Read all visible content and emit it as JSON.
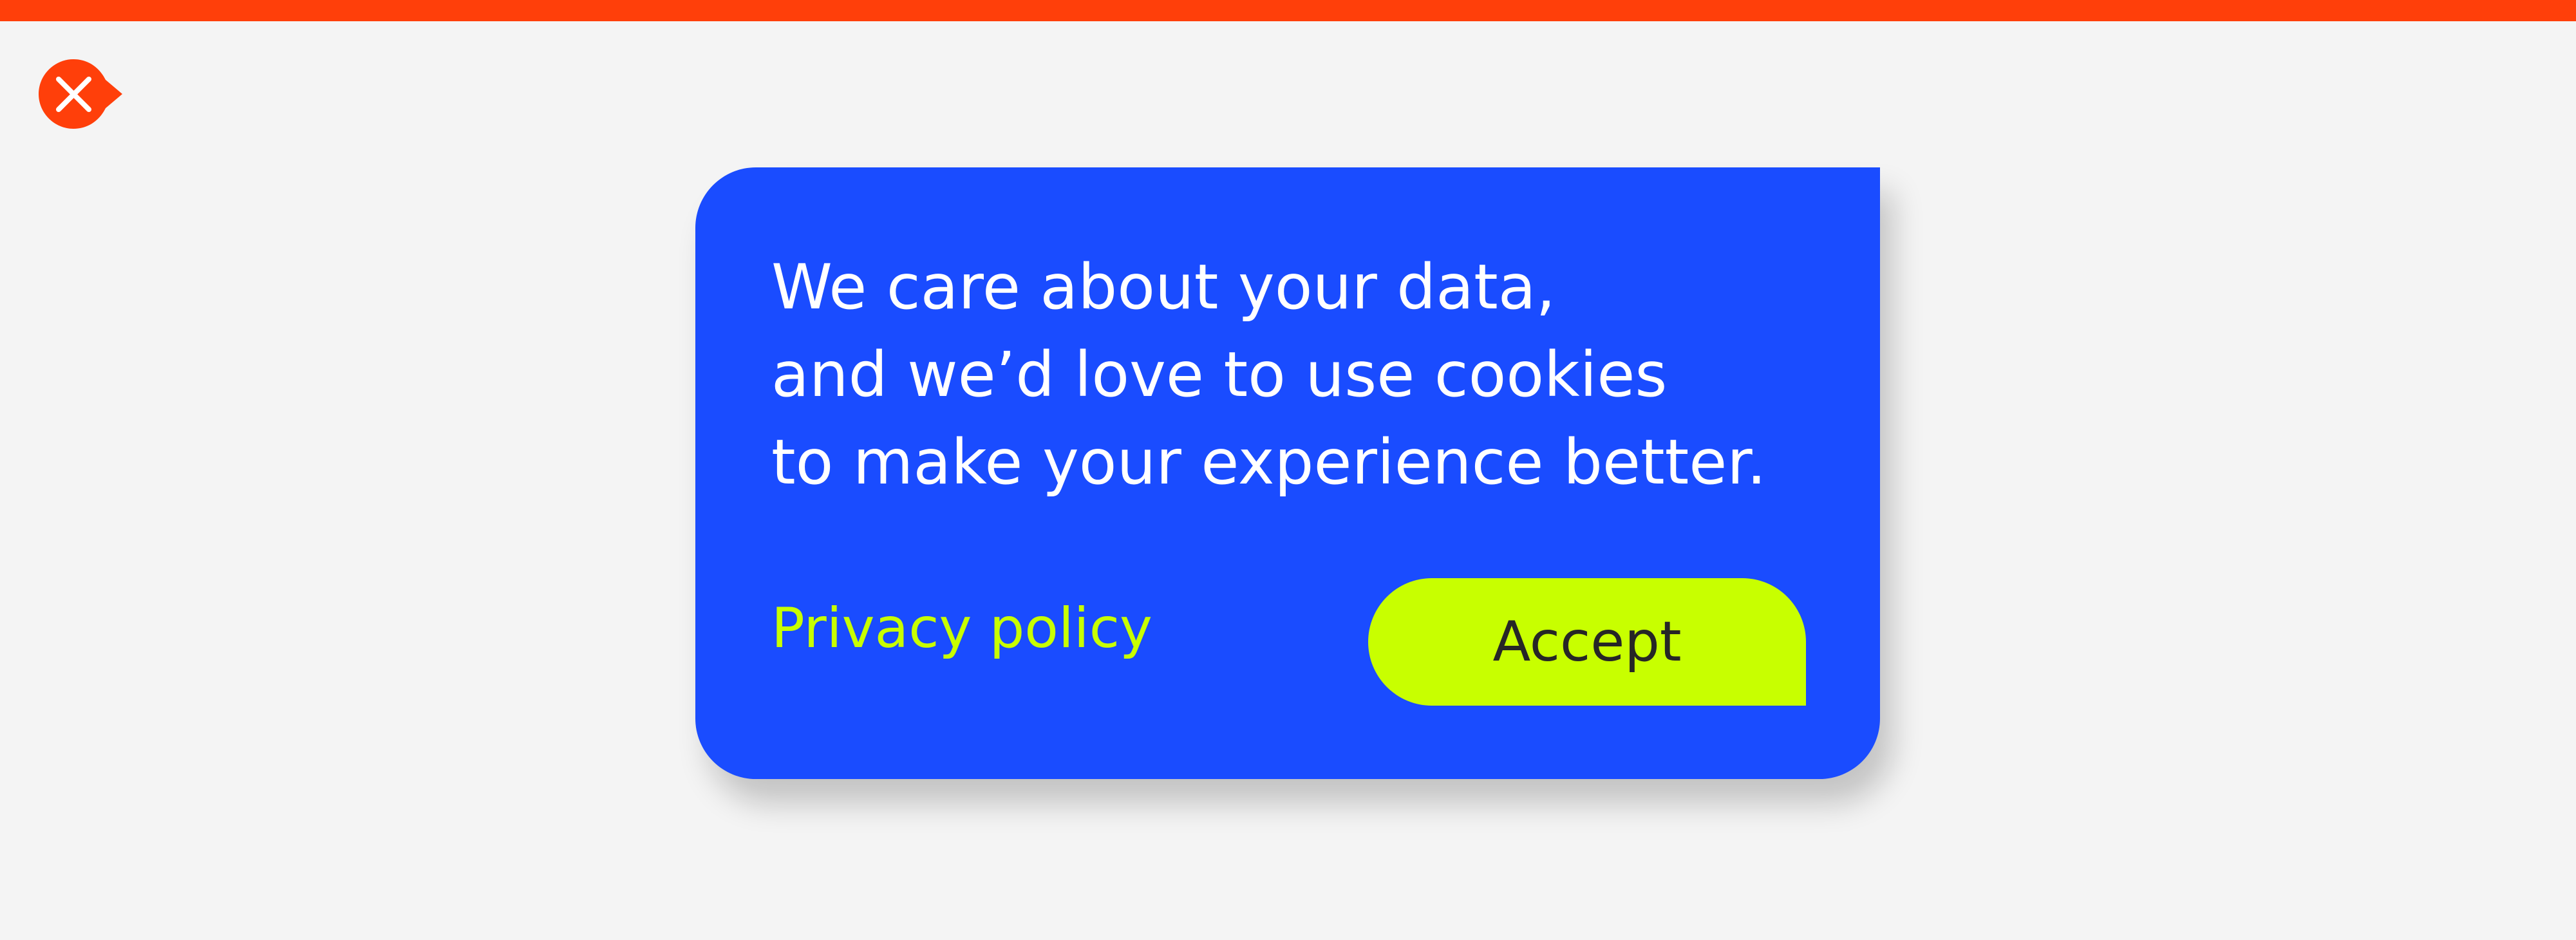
{
  "banner": {
    "message": "We care about your data,\nand we’d love to use cookies\nto make your experience better.",
    "privacy_link": "Privacy policy",
    "accept_label": "Accept"
  },
  "icons": {
    "close": "close-icon"
  },
  "colors": {
    "top_bar": "#ff3f0a",
    "background": "#f4f4f4",
    "card": "#1a4cff",
    "accent": "#c8ff00",
    "button_text": "#262626",
    "message_text": "#ffffff"
  }
}
